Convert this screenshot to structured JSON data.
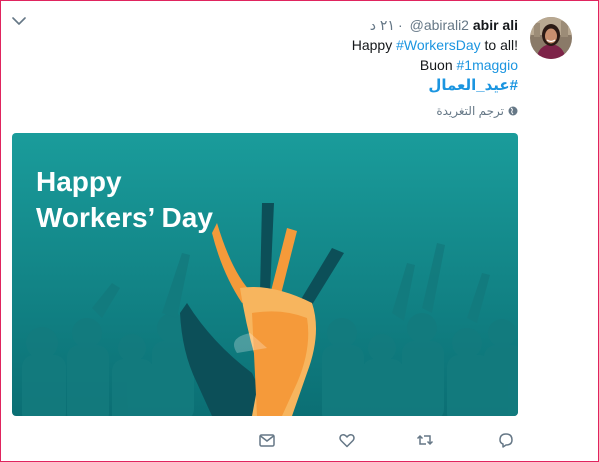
{
  "tweet": {
    "author_name": "abir ali",
    "handle": "@abirali2",
    "separator": "·",
    "timestamp": "٢١ د",
    "line1": {
      "prefix": "Happy ",
      "hashtag": "#WorkersDay",
      "suffix": " to all!"
    },
    "line2": {
      "prefix": "Buon ",
      "hashtag": "#1maggio"
    },
    "line3": {
      "hashtag": "#عيد_العمال"
    },
    "translate_label": "ترجم التغريدة"
  },
  "media": {
    "caption_line1": "Happy",
    "caption_line2": "Workers’ Day",
    "background_color": "#0f8b8d"
  },
  "actions": [
    "reply-icon",
    "retweet-icon",
    "like-icon",
    "message-icon"
  ],
  "colors": {
    "hashtag": "#1b95e0",
    "muted": "#657786",
    "frame_border": "#e0245e"
  }
}
